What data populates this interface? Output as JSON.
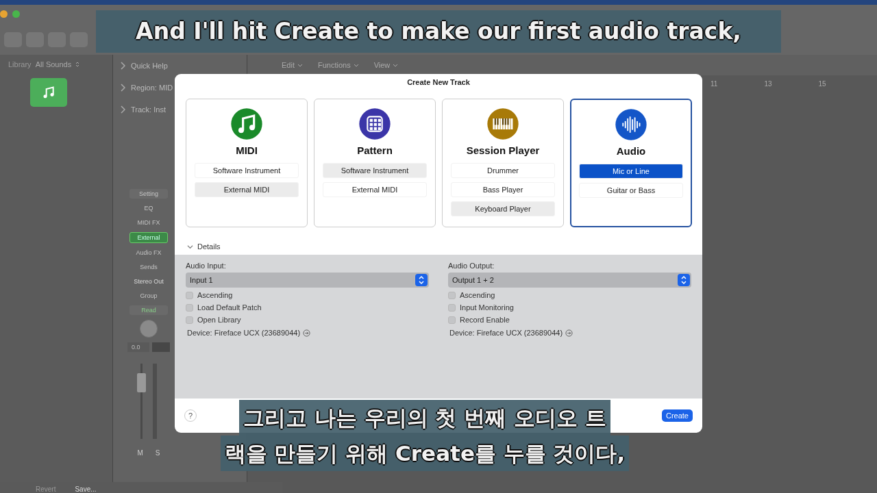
{
  "library": {
    "label": "Library",
    "filter": "All Sounds"
  },
  "inspector": {
    "rows": [
      {
        "label": "Quick Help"
      },
      {
        "label": "Region: MID"
      },
      {
        "label": "Track: Inst"
      }
    ]
  },
  "channel_strip": {
    "setting": "Setting",
    "eq": "EQ",
    "midi_fx": "MIDI FX",
    "instrument": "External",
    "audio_fx": "Audio FX",
    "sends": "Sends",
    "output": "Stereo Out",
    "group": "Group",
    "automation": "Read",
    "pan_value": "0.0",
    "mute": "M",
    "solo": "S"
  },
  "tracks_toolbar": {
    "menus": [
      "Edit",
      "Functions",
      "View"
    ]
  },
  "ruler": {
    "bars": [
      "11",
      "13",
      "15"
    ]
  },
  "footer_buttons": [
    "Revert",
    "Save..."
  ],
  "dialog": {
    "title": "Create New Track",
    "track_types": [
      {
        "name": "MIDI",
        "kind": "note",
        "color": "#1a8a2a",
        "selected": false,
        "options": [
          {
            "label": "Software Instrument",
            "selected": false
          },
          {
            "label": "External MIDI",
            "selected": true
          }
        ]
      },
      {
        "name": "Pattern",
        "kind": "grid",
        "color": "#3b35a8",
        "selected": false,
        "options": [
          {
            "label": "Software Instrument",
            "selected": true
          },
          {
            "label": "External MIDI",
            "selected": false
          }
        ]
      },
      {
        "name": "Session Player",
        "kind": "keys",
        "color": "#a87a08",
        "selected": false,
        "options": [
          {
            "label": "Drummer",
            "selected": false
          },
          {
            "label": "Bass Player",
            "selected": false
          },
          {
            "label": "Keyboard Player",
            "selected": true
          }
        ]
      },
      {
        "name": "Audio",
        "kind": "wave",
        "color": "#1456c8",
        "selected": true,
        "options": [
          {
            "label": "Mic or Line",
            "selected": true
          },
          {
            "label": "Guitar or Bass",
            "selected": false
          }
        ]
      }
    ],
    "details": {
      "label": "Details",
      "expanded": true,
      "columns": [
        {
          "label": "Audio Input:",
          "value": "Input 1",
          "checkboxes": [
            {
              "label": "Ascending",
              "checked": false
            },
            {
              "label": "Load Default Patch",
              "checked": false
            },
            {
              "label": "Open Library",
              "checked": false
            }
          ],
          "device": "Device: Fireface UCX (23689044)"
        },
        {
          "label": "Audio Output:",
          "value": "Output 1 + 2",
          "checkboxes": [
            {
              "label": "Ascending",
              "checked": false
            },
            {
              "label": "Input Monitoring",
              "checked": false
            },
            {
              "label": "Record Enable",
              "checked": false
            }
          ],
          "device": "Device: Fireface UCX (23689044)"
        }
      ]
    },
    "help": "?",
    "create": "Create"
  },
  "subtitles": {
    "english": "And I'll hit Create to make our first audio track,",
    "korean": [
      "그리고 나는 우리의 첫 번째 오디오 트",
      "랙을 만들기 위해 Create를 누를 것이다,"
    ]
  }
}
